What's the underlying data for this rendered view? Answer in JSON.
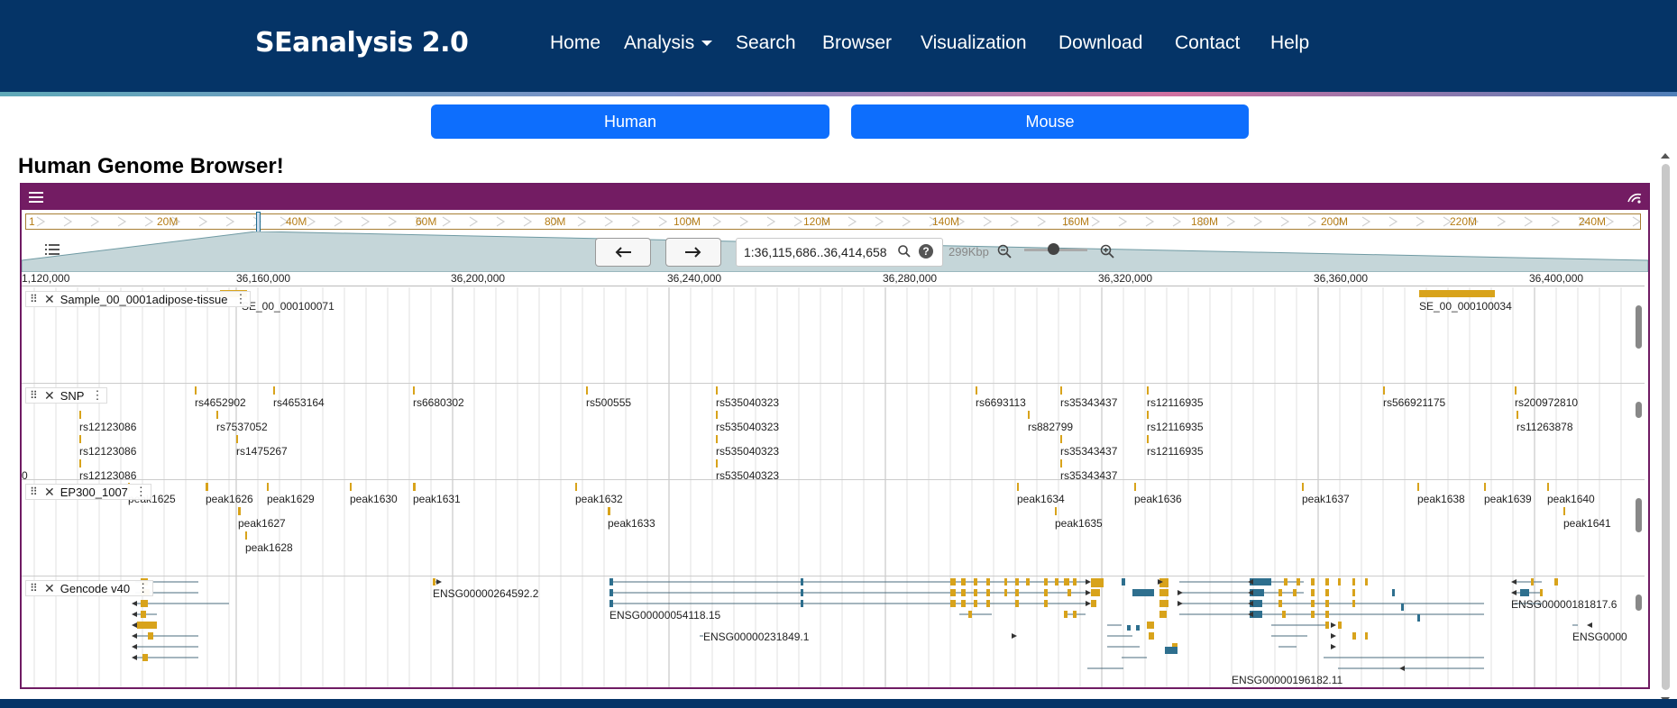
{
  "nav": {
    "brand": "SEanalysis 2.0",
    "items": [
      "Home",
      "Analysis",
      "Search",
      "Browser",
      "Visualization",
      "Download",
      "Contact",
      "Help"
    ]
  },
  "species": {
    "human": "Human",
    "mouse": "Mouse"
  },
  "page_title": "Human Genome Browser!",
  "browser": {
    "overview_ticks": [
      "1",
      "20M",
      "40M",
      "60M",
      "80M",
      "100M",
      "120M",
      "140M",
      "160M",
      "180M",
      "200M",
      "220M",
      "240M"
    ],
    "location": "1:36,115,686..36,414,658",
    "bp_size": "299Kbp",
    "coordinates": [
      "1,120,000",
      "36,160,000",
      "36,200,000",
      "36,240,000",
      "36,280,000",
      "36,320,000",
      "36,360,000",
      "36,400,000"
    ],
    "tracks": {
      "adipose": {
        "name": "Sample_00_0001adipose-tissue",
        "features": [
          "SE_00_000100071",
          "SE_00_000100034"
        ]
      },
      "snp": {
        "name": "SNP",
        "labels": [
          "rs4652902",
          "rs4653164",
          "rs6680302",
          "rs500555",
          "rs535040323",
          "rs6693113",
          "rs35343437",
          "rs12116935",
          "rs566921175",
          "rs200972810",
          "rs12123086",
          "rs7537052",
          "rs535040323",
          "rs882799",
          "rs12116935",
          "rs11263878",
          "rs12123086",
          "rs1475267",
          "rs535040323",
          "rs35343437",
          "rs12116935",
          "rs12123086",
          "rs535040323",
          "rs35343437",
          "0"
        ]
      },
      "ep300": {
        "name": "EP300_1007",
        "labels": [
          "peak1625",
          "peak1626",
          "peak1629",
          "peak1630",
          "peak1631",
          "peak1632",
          "peak1634",
          "peak1636",
          "peak1637",
          "peak1638",
          "peak1639",
          "peak1640",
          "peak1627",
          "peak1633",
          "peak1635",
          "peak1641",
          "peak1628"
        ]
      },
      "gencode": {
        "name": "Gencode v40",
        "labels": [
          "ENSG00000264592.2",
          "ENSG00000054118.15",
          "ENSG00000231849.1",
          "ENSG00000181817.6",
          "ENSG0000",
          "ENSG00000196182.11"
        ]
      }
    }
  },
  "colors": {
    "nav_bg": "#053467",
    "primary": "#0d6efd",
    "browser_header": "#731c63",
    "feature_gold": "#d8a31b",
    "feature_blue": "#2e6f8e"
  }
}
